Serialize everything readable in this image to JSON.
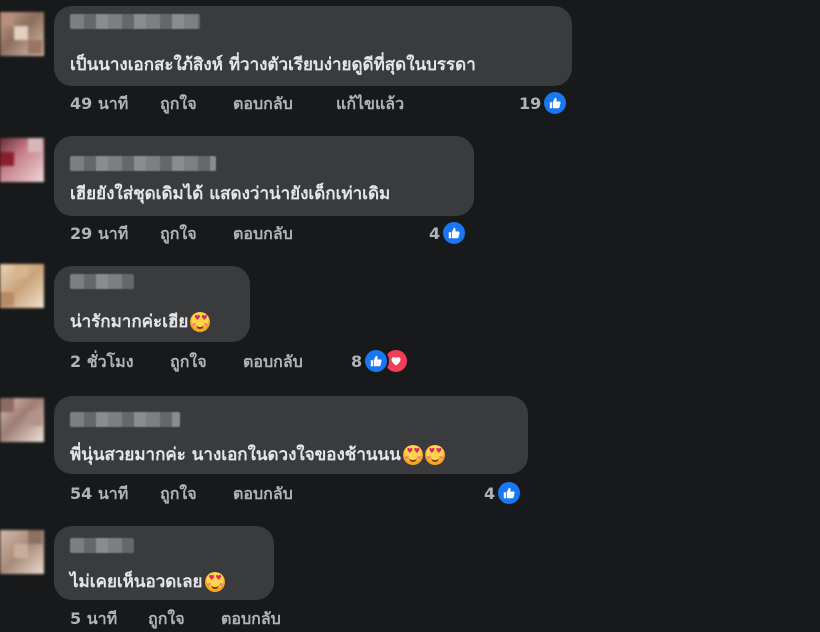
{
  "comments": [
    {
      "text": "เป็นนางเอกสะใภ้สิงห์ ที่วางตัวเรียบง่ายดูดีที่สุดในบรรดา",
      "emoji_count": 0,
      "time": "49 นาที",
      "like_label": "ถูกใจ",
      "reply_label": "ตอบกลับ",
      "edited_label": "แก้ไขแล้ว",
      "reaction_count": "19",
      "reactions": [
        "like-icon"
      ]
    },
    {
      "text": "เฮียยังใส่ชุดเดิมได้ แสดงว่าน่ายังเด็กเท่าเดิม",
      "emoji_count": 0,
      "time": "29 นาที",
      "like_label": "ถูกใจ",
      "reply_label": "ตอบกลับ",
      "reaction_count": "4",
      "reactions": [
        "like-icon"
      ]
    },
    {
      "text": "น่ารักมากค่ะเฮีย",
      "emoji_count": 1,
      "emoji": "smiling-face-with-hearts",
      "time": "2 ชั่วโมง",
      "like_label": "ถูกใจ",
      "reply_label": "ตอบกลับ",
      "reaction_count": "8",
      "reactions": [
        "like-icon",
        "love-icon"
      ]
    },
    {
      "text": "พี่นุ่นสวยมากค่ะ นางเอกในดวงใจของช้านนน",
      "emoji_count": 2,
      "emoji": "smiling-face-with-hearts",
      "time": "54 นาที",
      "like_label": "ถูกใจ",
      "reply_label": "ตอบกลับ",
      "reaction_count": "4",
      "reactions": [
        "like-icon"
      ]
    },
    {
      "text": "ไม่เคยเห็นอวดเลย",
      "emoji_count": 1,
      "emoji": "smiling-face-with-hearts",
      "time": "5 นาที",
      "like_label": "ถูกใจ",
      "reply_label": "ตอบกลับ"
    }
  ],
  "colors": {
    "background": "#18191a",
    "bubble": "#3a3b3c",
    "text": "#e4e6eb",
    "meta": "#b0b3b8",
    "like": "#1877f2",
    "love": "#f33e58"
  }
}
